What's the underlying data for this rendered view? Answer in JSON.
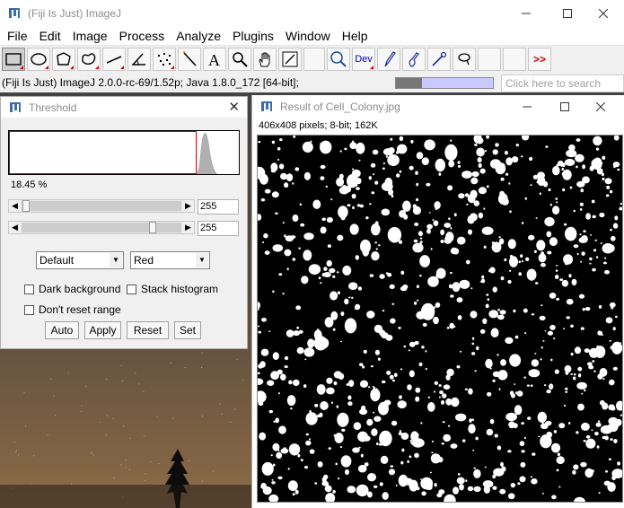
{
  "main_window": {
    "title": "(Fiji Is Just) ImageJ",
    "menu": [
      "File",
      "Edit",
      "Image",
      "Process",
      "Analyze",
      "Plugins",
      "Window",
      "Help"
    ],
    "tools": [
      "rectangle-tool",
      "oval-tool",
      "polygon-tool",
      "freehand-tool",
      "line-tool",
      "angle-tool",
      "point-tool",
      "wand-tool",
      "text-tool",
      "magnifier-tool",
      "hand-tool",
      "color-picker-tool",
      "lut-tool",
      "dev-tool",
      "pencil-tool",
      "brush-tool",
      "pipette-tool",
      "lasso-tool",
      "empty-slot-1",
      "empty-slot-2",
      "more-tools"
    ],
    "dev_label": "Dev",
    "more_label": ">>",
    "status": "(Fiji Is Just) ImageJ 2.0.0-rc-69/1.52p; Java 1.8.0_172 [64-bit];",
    "progress": 0.27,
    "search_placeholder": "Click here to search"
  },
  "threshold": {
    "title": "Threshold",
    "percent": "18.45 %",
    "slider1_value": "255",
    "slider2_value": "255",
    "method": "Default",
    "mode": "Red",
    "dark_background": "Dark background",
    "stack_histogram": "Stack histogram",
    "dont_reset": "Don't reset range",
    "buttons": {
      "auto": "Auto",
      "apply": "Apply",
      "reset": "Reset",
      "set": "Set"
    }
  },
  "result": {
    "title": "Result of Cell_Colony.jpg",
    "info": "406x408 pixels; 8-bit; 162K"
  },
  "colors": {
    "accent_red": "#cc0000",
    "progress_bg": "#c9c9ff"
  }
}
